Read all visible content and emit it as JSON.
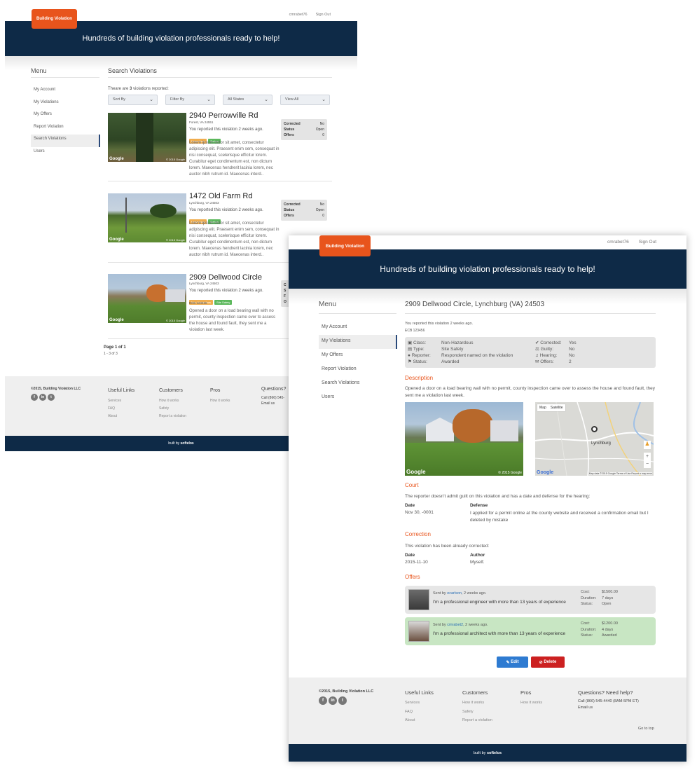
{
  "brand": {
    "logo_text": "Building Violation",
    "banner": "Hundreds of building violation professionals ready to help!",
    "user": "cmrabet76",
    "signout": "Sign Out"
  },
  "menu": {
    "title": "Menu",
    "items": [
      "My Account",
      "My Violations",
      "My Offers",
      "Report Violation",
      "Search Violations",
      "Users"
    ]
  },
  "search": {
    "title": "Search Violations",
    "count_prefix": "Theare are ",
    "count": "3",
    "count_suffix": " violations reported:",
    "filters": [
      "Sort By",
      "Filter By",
      "All States",
      "View All"
    ],
    "items": [
      {
        "title": "2940 Perrowville Rd",
        "location": "Forest, VA 24551",
        "reported": "You reported this violation 2 weeks ago.",
        "tags": [
          "Hazardous",
          "Before"
        ],
        "code": "",
        "desc": "Lorem ipsum dolor sit amet, consectetur adipiscing elit. Praesent enim sem, consequat in nisi consequat, scelerisque efficitur lorem. Curabitur eget condimentum est, non dictum lorem. Maecenas hendrerit lacinia lorem, nec auctor nibh rutrum id. Maecenas interd..",
        "stats": [
          [
            "Corrected",
            "No"
          ],
          [
            "Status",
            "Open"
          ],
          [
            "Offers",
            "0"
          ]
        ]
      },
      {
        "title": "1472 Old Farm Rd",
        "location": "Lynchburg, VA 24503",
        "reported": "You reported this violation 2 weeks ago.",
        "tags": [
          "Hazardous",
          "Before"
        ],
        "code": "",
        "desc": "Lorem ipsum dolor sit amet, consectetur adipiscing elit. Praesent enim sem, consequat in nisi consequat, scelerisque efficitur lorem. Curabitur eget condimentum est, non dictum lorem. Maecenas hendrerit lacinia lorem, nec auctor nibh rutrum id. Maecenas interd..",
        "stats": [
          [
            "Corrected",
            "No"
          ],
          [
            "Status",
            "Open"
          ],
          [
            "Offers",
            "0"
          ]
        ]
      },
      {
        "title": "2909 Dellwood Circle",
        "location": "Lynchburg, VA 24503",
        "reported": "You reported this violation 2 weeks ago.",
        "tags": [
          "Non-Hazardous",
          "Site Safety"
        ],
        "code": "ECB 123456",
        "desc": "Opened a door on a load bearing wall with no permit, county inspection came over to assess the house and found fault, they sent me a violation last week.",
        "stats": [
          [
            "C",
            ""
          ],
          [
            "S",
            ""
          ],
          [
            "F",
            ""
          ],
          [
            "O",
            ""
          ]
        ]
      }
    ],
    "page": "Page 1 of 1",
    "range": "1 - 3 of 3"
  },
  "footer": {
    "copy": "©2015, Building Violation LLC",
    "useful": "Useful Links",
    "useful_items": [
      "Services",
      "FAQ",
      "About"
    ],
    "customers": "Customers",
    "customer_items": [
      "How it works",
      "Safety",
      "Report a violation"
    ],
    "pros": "Pros",
    "pros_items": [
      "How it works"
    ],
    "questions_short": "Questions?",
    "call_short": "Call (866) 545-",
    "email": "Email us",
    "questions": "Questions? Need help?",
    "call": "Call (866) 545-4440 (8AM-5PM ET)",
    "gototop": "Go to top",
    "built_pre": "built by ",
    "built": "softelos"
  },
  "detail": {
    "title": "2909 Dellwood Circle, Lynchburg (VA) 24503",
    "reported": "You reported this violation 2 weeks ago.",
    "code": "ECB 123456",
    "info_left": [
      [
        "Class:",
        "Non-Hazardous"
      ],
      [
        "Type:",
        "Site Safety"
      ],
      [
        "Reporter:",
        "Respondent named on the violation"
      ],
      [
        "Status:",
        "Awarded"
      ]
    ],
    "info_right": [
      [
        "Corrected:",
        "Yes"
      ],
      [
        "Guilty:",
        "No"
      ],
      [
        "Hearing:",
        "No"
      ],
      [
        "Offers:",
        "2"
      ]
    ],
    "desc_title": "Description",
    "desc": "Opened a door on a load bearing wall with no permit, county inspection came over to assess the house and found fault, they sent me a violation last week.",
    "map_tabs": [
      "Map",
      "Satellite"
    ],
    "map_city": "Lynchburg",
    "map_credit": "Map data ©2015 Google   Terms of Use   Report a map error",
    "google": "Google",
    "photo_credit": "© 2015 Google",
    "court_title": "Court",
    "court_text": "The reporter doesn't admit guilt on this violation and has a date and defense for the hearing:",
    "date_label": "Date",
    "defense_label": "Defense",
    "court_date": "Nov 30, -0001",
    "defense": "I applied for a permit online at the county website and received a confirmation email but I deleted by mistake",
    "corr_title": "Correction",
    "corr_text": "This violation has been already corrected:",
    "author_label": "Author",
    "corr_date": "2015-11-10",
    "author": "Myself.",
    "offers_title": "Offers",
    "offers": [
      {
        "sent": "Sent by ",
        "user": "ecarlson",
        "ago": ", 2 weeks ago.",
        "text": "I'm a professional engineer with more than 13 years of experience",
        "cost": "$1500.00",
        "duration": "7 days",
        "status": "Open"
      },
      {
        "sent": "Sent by ",
        "user": "cmrabet2",
        "ago": ", 2 weeks ago.",
        "text": "I'm a professional architect with more than 13 years of experience",
        "cost": "$1200.00",
        "duration": "4 days",
        "status": "Awarded"
      }
    ],
    "cost_l": "Cost:",
    "dur_l": "Duration:",
    "status_l": "Status:",
    "edit": "Edit",
    "delete": "Delete"
  }
}
